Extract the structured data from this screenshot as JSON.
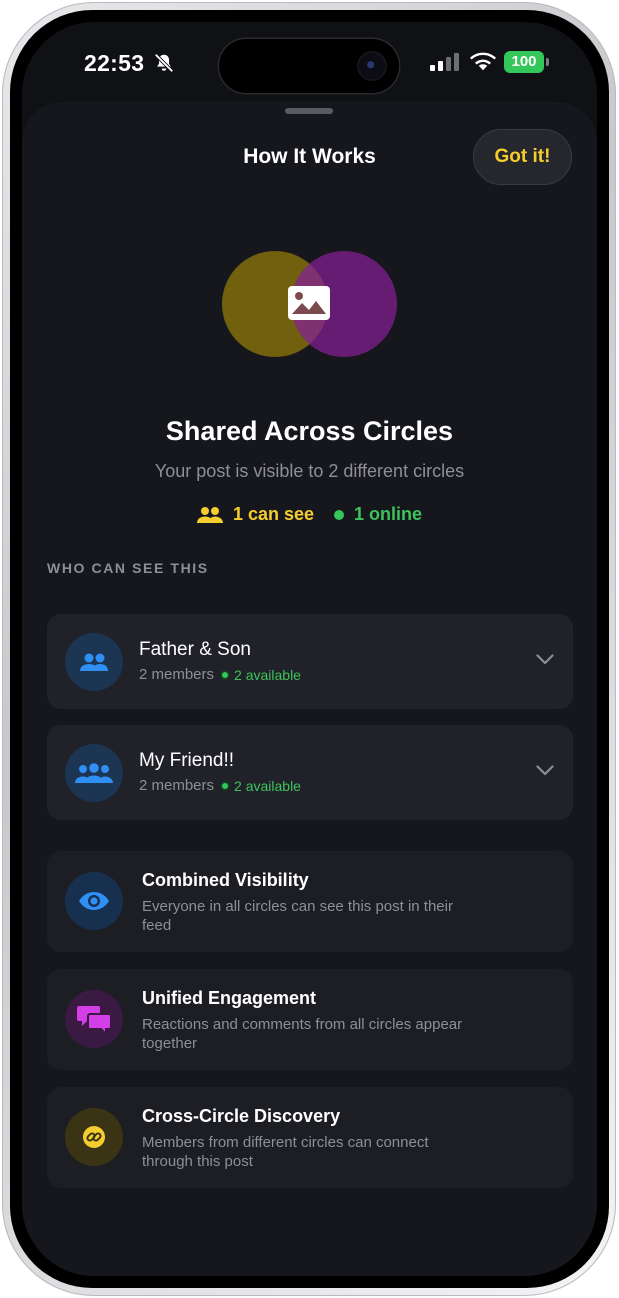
{
  "status_bar": {
    "time": "22:53",
    "battery": "100",
    "silent_icon": "bell-slash-icon",
    "signal_icon": "cellular-signal-icon",
    "wifi_icon": "wifi-icon"
  },
  "sheet": {
    "title": "How It Works",
    "got_it_label": "Got it!"
  },
  "hero": {
    "icon": "image-icon",
    "title": "Shared Across Circles",
    "subtitle": "Your post is visible to 2 different circles",
    "can_see_label": "1 can see",
    "online_label": "1 online"
  },
  "section_label": "WHO CAN SEE THIS",
  "circles": [
    {
      "name": "Father & Son",
      "members": "2 members",
      "available": "2 available",
      "icon": "people-icon"
    },
    {
      "name": "My Friend!!",
      "members": "2 members",
      "available": "2 available",
      "icon": "group-icon"
    }
  ],
  "features": [
    {
      "title": "Combined Visibility",
      "desc": "Everyone in all circles can see this post in their feed",
      "icon": "eye-icon"
    },
    {
      "title": "Unified Engagement",
      "desc": "Reactions and comments from all circles appear together",
      "icon": "chat-bubbles-icon"
    },
    {
      "title": "Cross-Circle Discovery",
      "desc": "Members from different circles can connect through this post",
      "icon": "link-icon"
    }
  ],
  "colors": {
    "accent_yellow": "#f5cd2f",
    "online_green": "#34c759",
    "sheet_bg": "#16171c",
    "card_bg": "#212229"
  }
}
